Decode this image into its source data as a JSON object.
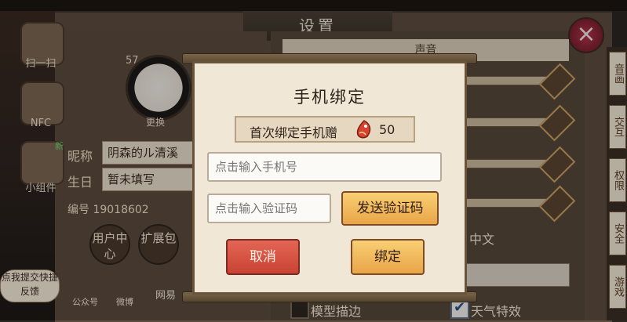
{
  "settings": {
    "title": "设置",
    "close_icon": "close-icon"
  },
  "left_bar": {
    "items": [
      {
        "label": "扫一扫",
        "icon": "scan-icon"
      },
      {
        "label": "NFC",
        "icon": "nfc-icon"
      },
      {
        "label": "小组件",
        "icon": "widget-icon"
      }
    ],
    "new_badge": "新"
  },
  "profile": {
    "level": "57",
    "change_label": "更换",
    "nickname_label": "昵称",
    "nickname_value": "阴森的ル清溪",
    "birthday_label": "生日",
    "birthday_value": "暂未填写",
    "id_label": "编号",
    "id_value": "19018602",
    "user_center_label": "用户中心",
    "expansion_label": "扩展包"
  },
  "social": {
    "wechat_label": "公众号",
    "weibo_label": "微博",
    "netease_label": "网易"
  },
  "feedback": {
    "label": "点我提交快捷反馈"
  },
  "right_panel": {
    "sound_label": "声音",
    "language_value": "中文",
    "model_outline_label": "模型描边",
    "weather_effect_label": "天气特效",
    "model_outline_checked": false,
    "weather_effect_checked": true
  },
  "side_tabs": [
    {
      "label": "音画"
    },
    {
      "label": "交互"
    },
    {
      "label": "权限"
    },
    {
      "label": "安全"
    },
    {
      "label": "游戏"
    }
  ],
  "dialog": {
    "title": "手机绑定",
    "reward_text": "首次绑定手机赠",
    "reward_count": "50",
    "reward_icon": "fish-icon",
    "phone_placeholder": "点击输入手机号",
    "code_placeholder": "点击输入验证码",
    "send_code_label": "发送验证码",
    "cancel_label": "取消",
    "bind_label": "绑定"
  },
  "colors": {
    "cancel": "#d4503f",
    "confirm": "#f2b95c",
    "accent_border": "#7d4b26"
  }
}
